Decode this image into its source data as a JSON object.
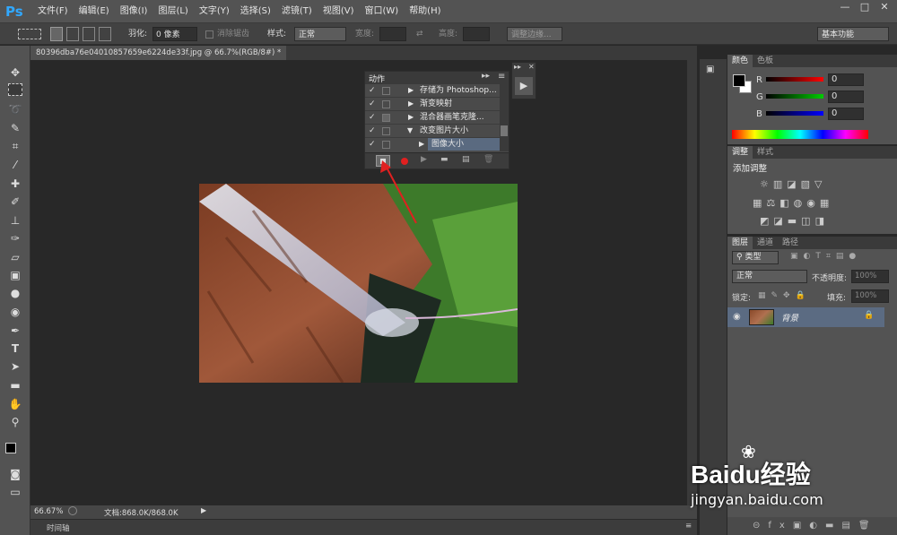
{
  "app": {
    "logo": "Ps"
  },
  "menu": [
    "文件(F)",
    "编辑(E)",
    "图像(I)",
    "图层(L)",
    "文字(Y)",
    "选择(S)",
    "滤镜(T)",
    "视图(V)",
    "窗口(W)",
    "帮助(H)"
  ],
  "window": {
    "minimize": "—",
    "maximize": "□",
    "close": "✕"
  },
  "options": {
    "feather_label": "羽化:",
    "feather_value": "0 像素",
    "antialias_label": "消除锯齿",
    "style_label": "样式:",
    "style_value": "正常",
    "width_label": "宽度:",
    "height_label": "高度:",
    "refine_edge": "调整边缘...",
    "workspace": "基本功能"
  },
  "document": {
    "tab_title": "80396dba76e04010857659e6224de33f.jpg @ 66.7%(RGB/8#) *",
    "zoom": "66.67%",
    "doc_info": "文档:868.0K/868.0K",
    "timeline": "时间轴"
  },
  "actions_panel": {
    "title": "动作",
    "rows": [
      {
        "label": "存储为 Photoshop..."
      },
      {
        "label": "渐变映射"
      },
      {
        "label": "混合器画笔克隆..."
      },
      {
        "label": "改变图片大小"
      },
      {
        "label": "图像大小"
      }
    ]
  },
  "color_panel": {
    "tabs": [
      "颜色",
      "色板"
    ],
    "r_label": "R",
    "g_label": "G",
    "b_label": "B",
    "r_value": "0",
    "g_value": "0",
    "b_value": "0"
  },
  "adjust_panel": {
    "tabs": [
      "调整",
      "样式"
    ],
    "add_label": "添加调整"
  },
  "layers_panel": {
    "tabs": [
      "图层",
      "通道",
      "路径"
    ],
    "kind_label": "类型",
    "blend_mode": "正常",
    "opacity_label": "不透明度:",
    "opacity_value": "100%",
    "lock_label": "锁定:",
    "fill_label": "填充:",
    "fill_value": "100%",
    "layer_name": "背景"
  },
  "watermark": {
    "brand": "Baidu经验",
    "url": "jingyan.baidu.com"
  },
  "colors": {
    "accent": "#31a8ff",
    "record": "#e02020",
    "arrow": "#e02020"
  }
}
